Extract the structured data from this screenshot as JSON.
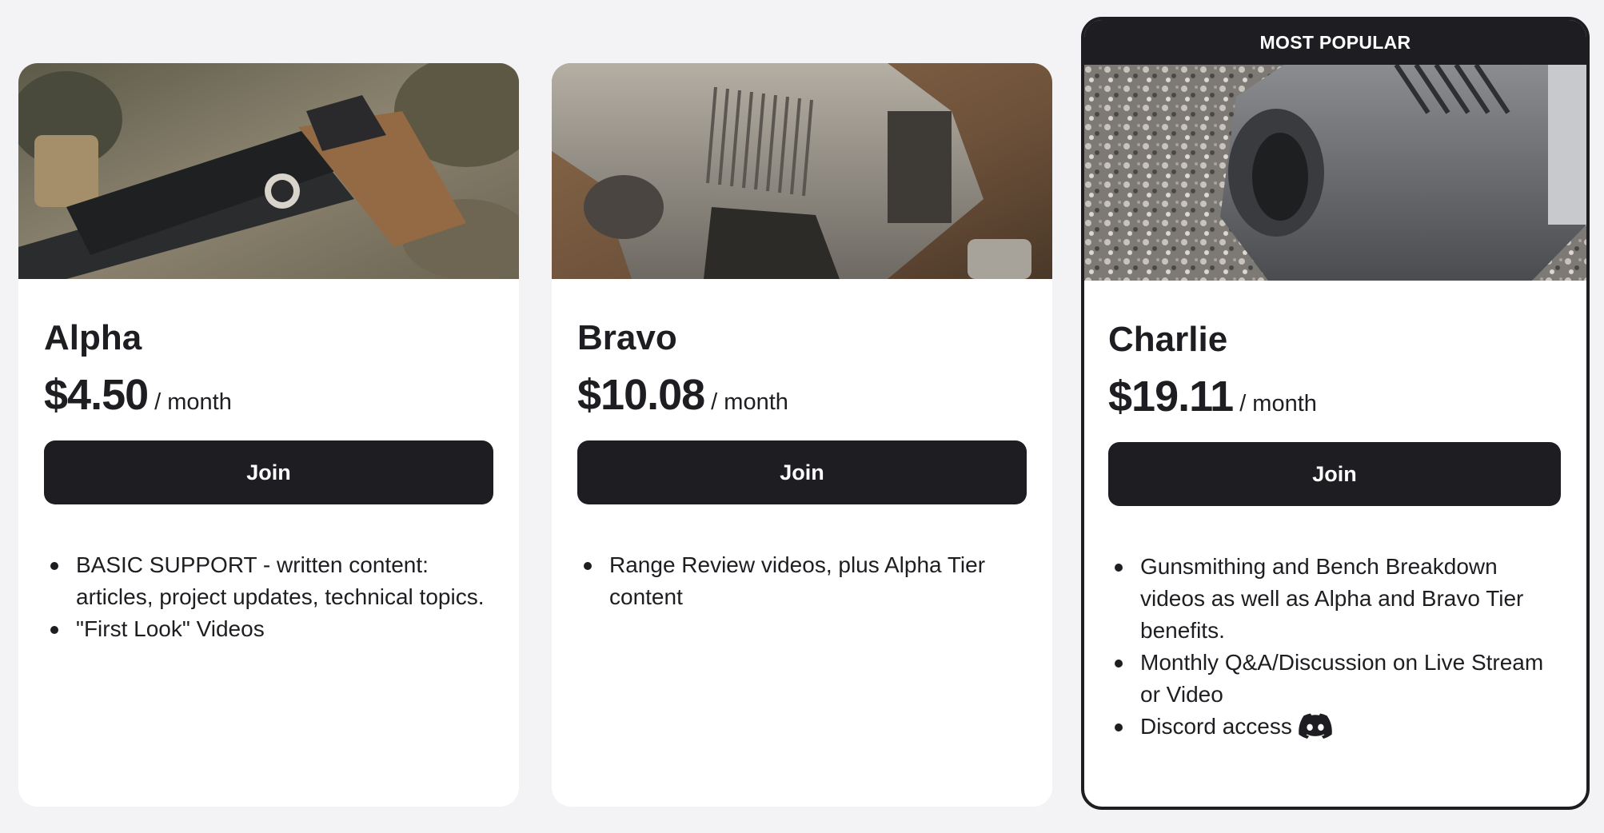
{
  "tiers": [
    {
      "name": "Alpha",
      "price": "$4.50",
      "period": "/ month",
      "join_label": "Join",
      "image": "pistol-grip-photo",
      "benefits": [
        "BASIC SUPPORT - written content: articles, project updates, technical topics.",
        "\"First Look\" Videos"
      ]
    },
    {
      "name": "Bravo",
      "price": "$10.08",
      "period": "/ month",
      "join_label": "Join",
      "image": "pistol-slide-photo",
      "benefits": [
        "Range Review videos, plus Alpha Tier content"
      ]
    },
    {
      "name": "Charlie",
      "price": "$19.11",
      "period": "/ month",
      "join_label": "Join",
      "image": "pistol-muzzle-photo",
      "badge": "MOST POPULAR",
      "benefits": [
        "Gunsmithing and Bench Breakdown videos as well as Alpha and Bravo Tier benefits.",
        "Monthly Q&A/Discussion on Live Stream or Video",
        "Discord access"
      ],
      "benefit_icon": "discord-icon"
    }
  ],
  "colors": {
    "background": "#f3f2f5",
    "card": "#ffffff",
    "button": "#1e1d21",
    "button_text": "#ffffff"
  }
}
